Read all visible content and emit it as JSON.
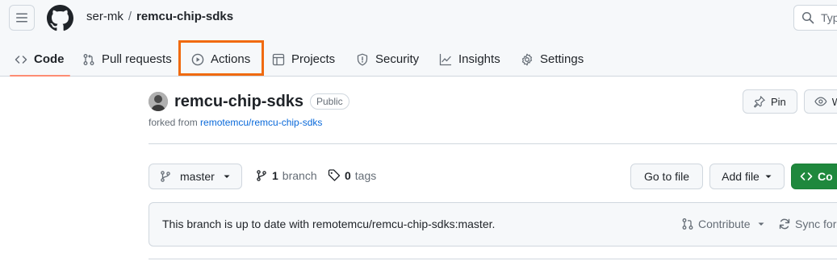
{
  "breadcrumb": {
    "owner": "ser-mk",
    "separator": "/",
    "repo": "remcu-chip-sdks"
  },
  "search": {
    "placeholder": "Typ"
  },
  "tabs": [
    {
      "label": "Code",
      "icon": "code-icon",
      "selected": true
    },
    {
      "label": "Pull requests",
      "icon": "pull-request-icon"
    },
    {
      "label": "Actions",
      "icon": "play-icon",
      "highlighted": true
    },
    {
      "label": "Projects",
      "icon": "table-icon"
    },
    {
      "label": "Security",
      "icon": "shield-icon"
    },
    {
      "label": "Insights",
      "icon": "graph-icon"
    },
    {
      "label": "Settings",
      "icon": "gear-icon"
    }
  ],
  "repo": {
    "name": "remcu-chip-sdks",
    "visibility": "Public",
    "forked_prefix": "forked from ",
    "forked_source": "remotemcu/remcu-chip-sdks",
    "pin_label": "Pin",
    "watch_label": "W"
  },
  "toolbar": {
    "branch": "master",
    "branch_count": "1",
    "branch_word": "branch",
    "tag_count": "0",
    "tag_word": "tags",
    "goto_file": "Go to file",
    "add_file": "Add file",
    "code": "Co"
  },
  "status": {
    "message": "This branch is up to date with remotemcu/remcu-chip-sdks:master.",
    "contribute": "Contribute",
    "sync": "Sync fork"
  },
  "colors": {
    "accent_underline": "#fd8c73",
    "highlight": "#f06a0f",
    "primary_green": "#1f883d",
    "link": "#0969da"
  }
}
